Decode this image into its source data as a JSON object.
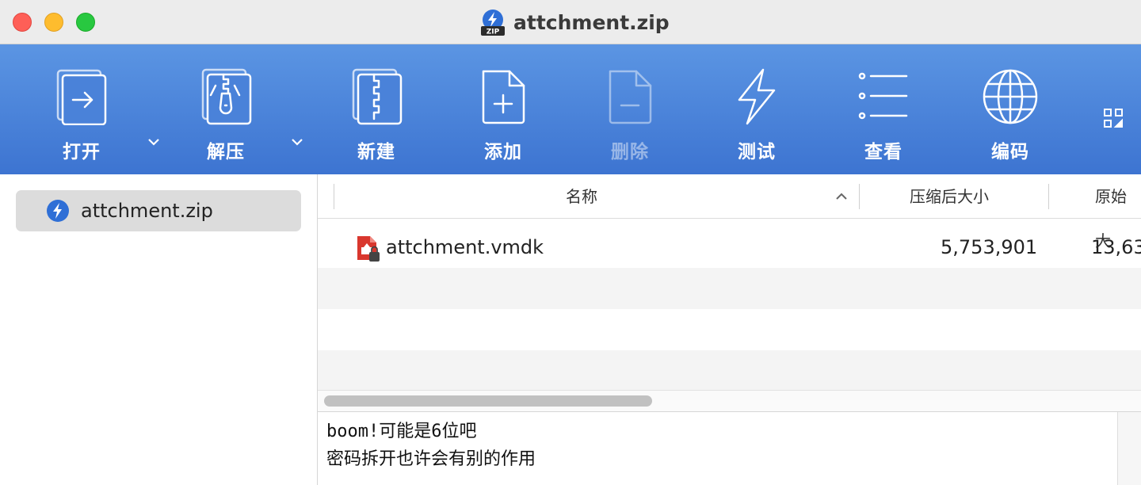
{
  "window": {
    "title": "attchment.zip"
  },
  "toolbar": {
    "open_label": "打开",
    "extract_label": "解压",
    "new_label": "新建",
    "add_label": "添加",
    "delete_label": "删除",
    "test_label": "测试",
    "view_label": "查看",
    "encoding_label": "编码"
  },
  "sidebar": {
    "items": [
      {
        "label": "attchment.zip",
        "icon": "archive-app-icon"
      }
    ]
  },
  "file_list": {
    "columns": {
      "name": "名称",
      "compressed": "压缩后大小",
      "original": "原始大"
    },
    "rows": [
      {
        "name": "attchment.vmdk",
        "compressed": "5,753,901",
        "original": "13,63",
        "icon": "locked-vmdk-file-icon"
      }
    ]
  },
  "comment": {
    "lines": [
      "boom!可能是6位吧",
      "密码拆开也许会有别的作用"
    ]
  },
  "colors": {
    "accent": "#3d74d1",
    "toolbar_top": "#5b95e3",
    "file_icon": "#d9372e"
  }
}
